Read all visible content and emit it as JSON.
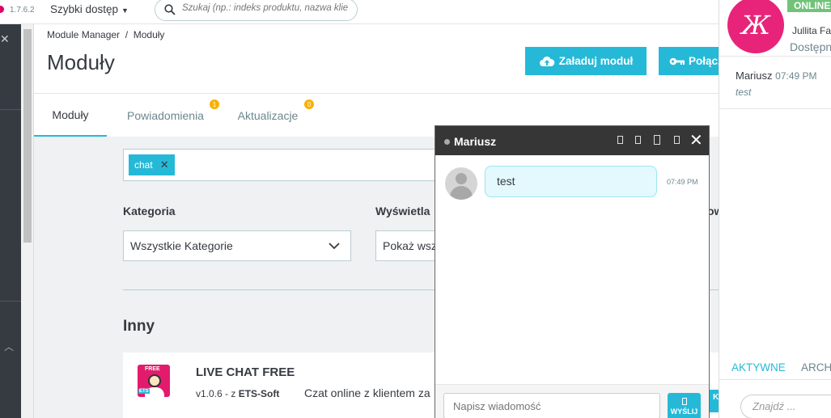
{
  "topbar": {
    "version": "1.7.6.2",
    "quick_access": "Szybki dostęp",
    "search_placeholder": "Szukaj (np.: indeks produktu, nazwa klie"
  },
  "header": {
    "breadcrumb": "Module Manager  /  Moduły",
    "title": "Moduły",
    "upload_button": "Załaduj moduł",
    "connect_button": "Połącz"
  },
  "tabs": [
    {
      "label": "Moduły",
      "badge": ""
    },
    {
      "label": "Powiadomienia",
      "badge": "1"
    },
    {
      "label": "Aktualizacje",
      "badge": "0"
    }
  ],
  "filters": {
    "chip": "chat",
    "category_label": "Kategoria",
    "category_value": "Wszystkie Kategorie",
    "display_label": "Wyświetla",
    "display_value": "Pokaż wsz",
    "partial_label": "ow"
  },
  "section": {
    "title": "Inny",
    "module": {
      "name": "LIVE CHAT FREE",
      "version_prefix": "v1.0.6 - z ",
      "author": "ETS-Soft",
      "description": "Czat online z klientem za",
      "icon_free": "FREE",
      "icon_ets": "ETS"
    }
  },
  "chat": {
    "name": "Mariusz",
    "message": "test",
    "time": "07:49 PM",
    "input_placeholder": "Napisz wiadomość",
    "send_label": "WYŚLIJ",
    "side_fragment": "K"
  },
  "right_panel": {
    "status": "ONLINE",
    "name": "Jullita Fas",
    "availability": "Dostępn",
    "conv_name": "Mariusz",
    "conv_time": "07:49 PM",
    "conv_message": "test",
    "tab_active": "AKTYWNE",
    "tab_other": "ARCH",
    "search_placeholder": "Znajdź ..."
  },
  "colors": {
    "accent": "#25b9d7",
    "online": "#72c279",
    "badge": "#fab000",
    "brand": "#e8247a"
  }
}
